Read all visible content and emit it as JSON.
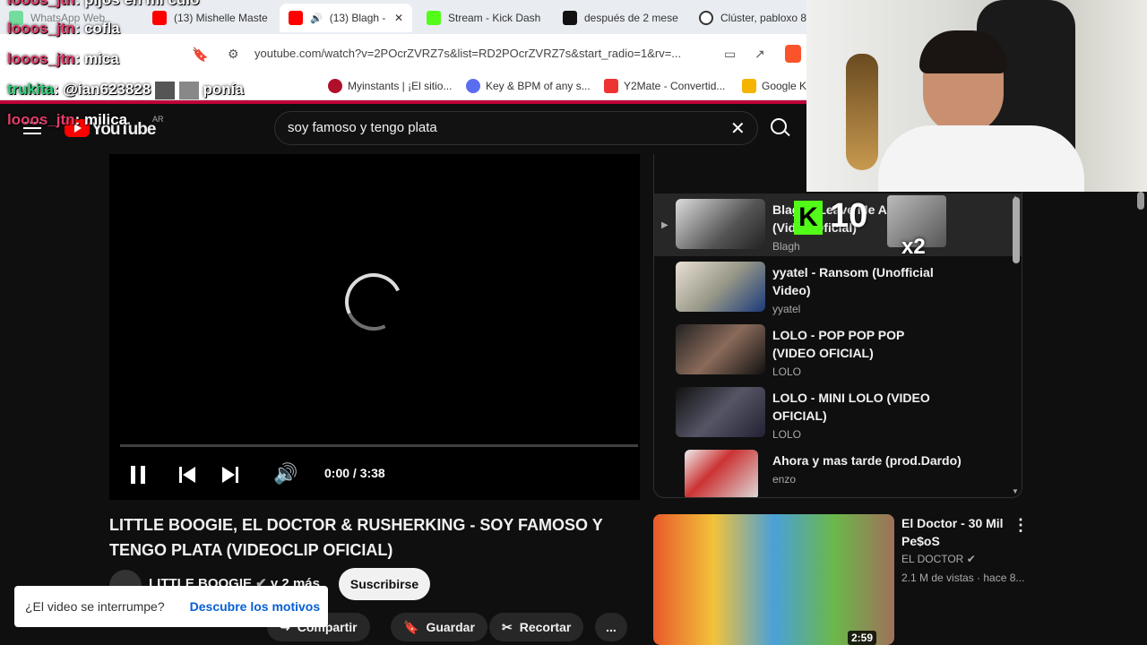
{
  "browser": {
    "tabs": [
      {
        "label": "WhatsApp Web"
      },
      {
        "label": "(13) Mishelle Maste"
      },
      {
        "label": "(13) Blagh -"
      },
      {
        "label": "Stream - Kick Dash"
      },
      {
        "label": "después de 2 mese"
      },
      {
        "label": "Clúster, pabloxo 8"
      }
    ],
    "url": "youtube.com/watch?v=2POcrZVRZ7s&list=RD2POcrZVRZ7s&start_radio=1&rv=...",
    "bookmarks": [
      {
        "label": "Myinstants | ¡El sitio..."
      },
      {
        "label": "Key & BPM of any s..."
      },
      {
        "label": "Y2Mate - Convertid..."
      },
      {
        "label": "Google K"
      }
    ]
  },
  "youtube": {
    "logo": "YouTube",
    "country": "AR",
    "search_value": "soy famoso y tengo plata",
    "player": {
      "time": "0:00 / 3:38",
      "progress": 0
    },
    "video_title": "LITTLE BOOGIE, EL DOCTOR & RUSHERKING - SOY FAMOSO Y TENGO PLATA (VIDEOCLIP OFICIAL)",
    "channel": "LITTLE BOOGIE",
    "channel_more": "y 2 más",
    "subscribe": "Suscribirse",
    "toast": {
      "text": "¿El video se interrumpe?",
      "link": "Descubre los motivos"
    },
    "actions": {
      "share": "Compartir",
      "save": "Guardar",
      "clip": "Recortar",
      "more": "..."
    },
    "playlist": [
      {
        "title": "Blagh - Leave Me Alone (Video Oficial)",
        "artist": "Blagh",
        "playing": true
      },
      {
        "title": "yyatel - Ransom (Unofficial Video)",
        "artist": "yyatel"
      },
      {
        "title": "LOLO - POP POP POP (VIDEO OFICIAL)",
        "artist": "LOLO"
      },
      {
        "title": "LOLO - MINI LOLO (VIDEO OFICIAL)",
        "artist": "LOLO"
      },
      {
        "title": "Ahora y mas tarde (prod.Dardo)",
        "artist": "enzo"
      }
    ],
    "recommendation": {
      "title": "El Doctor - 30 Mil Pe$oS",
      "channel": "EL DOCTOR",
      "meta": "2.1 M de vistas · hace 8...",
      "duration": "2:59"
    }
  },
  "chat": [
    {
      "user": "looos_jtn",
      "msg": ": pijos en mi culo"
    },
    {
      "user": "looos_jtn",
      "msg": ": cofla"
    },
    {
      "user": "looos_jtn",
      "msg": ": mica"
    },
    {
      "user": "trukita",
      "msg": ": @ian623828"
    },
    {
      "user": "",
      "msg": "ponía"
    },
    {
      "user": "looos_jtn",
      "msg": ": milica"
    }
  ],
  "kick_overlay": {
    "count": "10",
    "multiplier": "x2"
  },
  "colors": {
    "accent_red": "#ff0000",
    "link_blue": "#065fd4",
    "chat_user": "#e33c6a",
    "kick_green": "#53fc18"
  }
}
